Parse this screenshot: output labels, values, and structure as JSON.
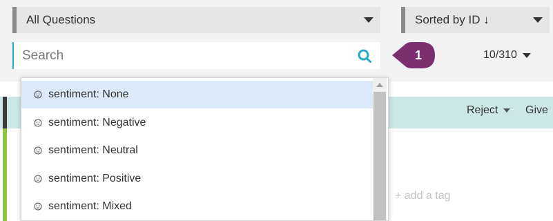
{
  "filter": {
    "selected": "All Questions"
  },
  "sort": {
    "selected": "Sorted by ID ↓"
  },
  "search": {
    "placeholder": "Search"
  },
  "callout": {
    "number": "1"
  },
  "pager": {
    "text": "10/310"
  },
  "item_bar": {
    "reject_label": "Reject",
    "give_label": "Give"
  },
  "tags": {
    "add_tag_label": "+ add a tag"
  },
  "dropdown": {
    "items": [
      {
        "label": "sentiment: None"
      },
      {
        "label": "sentiment: Negative"
      },
      {
        "label": "sentiment: Neutral"
      },
      {
        "label": "sentiment: Positive"
      },
      {
        "label": "sentiment: Mixed"
      }
    ],
    "selected_index": 0
  },
  "colors": {
    "accent": "#2aa7c9",
    "callout": "#7b2f6e",
    "item_bar": "#cde7e6",
    "selection": "#dce9f8",
    "status_green": "#8cc63f"
  },
  "icons": {
    "search": "search-icon",
    "item": "smiley-icon",
    "caret": "caret-down-icon"
  }
}
